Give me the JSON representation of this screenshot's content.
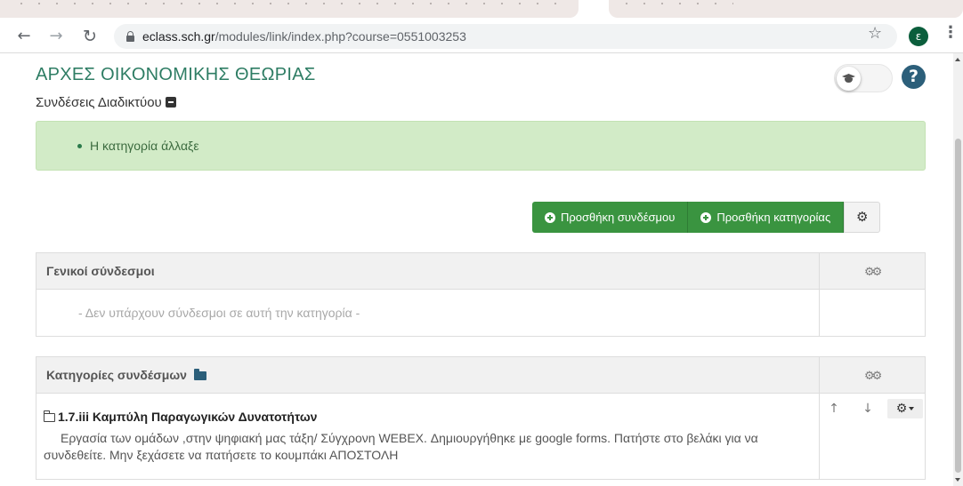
{
  "browser": {
    "url_host": "eclass.sch.gr",
    "url_path": "/modules/link/index.php?course=0551003253",
    "avatar_letter": "ε"
  },
  "page": {
    "course_title": "ΑΡΧΕΣ ΟΙΚΟΝΟΜΙΚΗΣ ΘΕΩΡΙΑΣ",
    "module_title": "Συνδέσεις Διαδικτύου",
    "help_label": "?"
  },
  "alert": {
    "message": "Η κατηγορία άλλαξε",
    "background": "#d2ebc7"
  },
  "actions": {
    "add_link": "Προσθήκη συνδέσμου",
    "add_category": "Προσθήκη κατηγορίας",
    "accent": "#3a9440"
  },
  "general_links": {
    "header": "Γενικοί σύνδεσμοι",
    "empty_message": "- Δεν υπάρχουν σύνδεσμοι σε αυτή την κατηγορία -"
  },
  "categories": {
    "header": "Κατηγορίες συνδέσμων",
    "items": [
      {
        "title": "1.7.iii Καμπύλη Παραγωγικών Δυνατοτήτων",
        "description": "Εργασία των ομάδων ,στην ψηφιακή μας τάξη/ Σύγχρονη WEBEX. Δημιουργήθηκε με google forms. Πατήστε στο βελάκι για να συνδεθείτε. Μην ξεχάσετε να πατήσετε το κουμπάκι ΑΠΟΣΤΟΛΗ"
      }
    ]
  },
  "icons": {
    "back": "back-arrow-icon",
    "forward": "forward-arrow-icon",
    "reload": "reload-icon",
    "lock": "lock-icon",
    "star": "star-icon",
    "menu": "kebab-menu-icon",
    "toggle": "graduation-cap-icon",
    "help": "help-icon",
    "collapse": "minus-square-icon",
    "settings": "gear-icon",
    "bulk_settings": "gears-icon",
    "folder": "folder-icon",
    "up": "arrow-up-icon",
    "down": "arrow-down-icon"
  }
}
